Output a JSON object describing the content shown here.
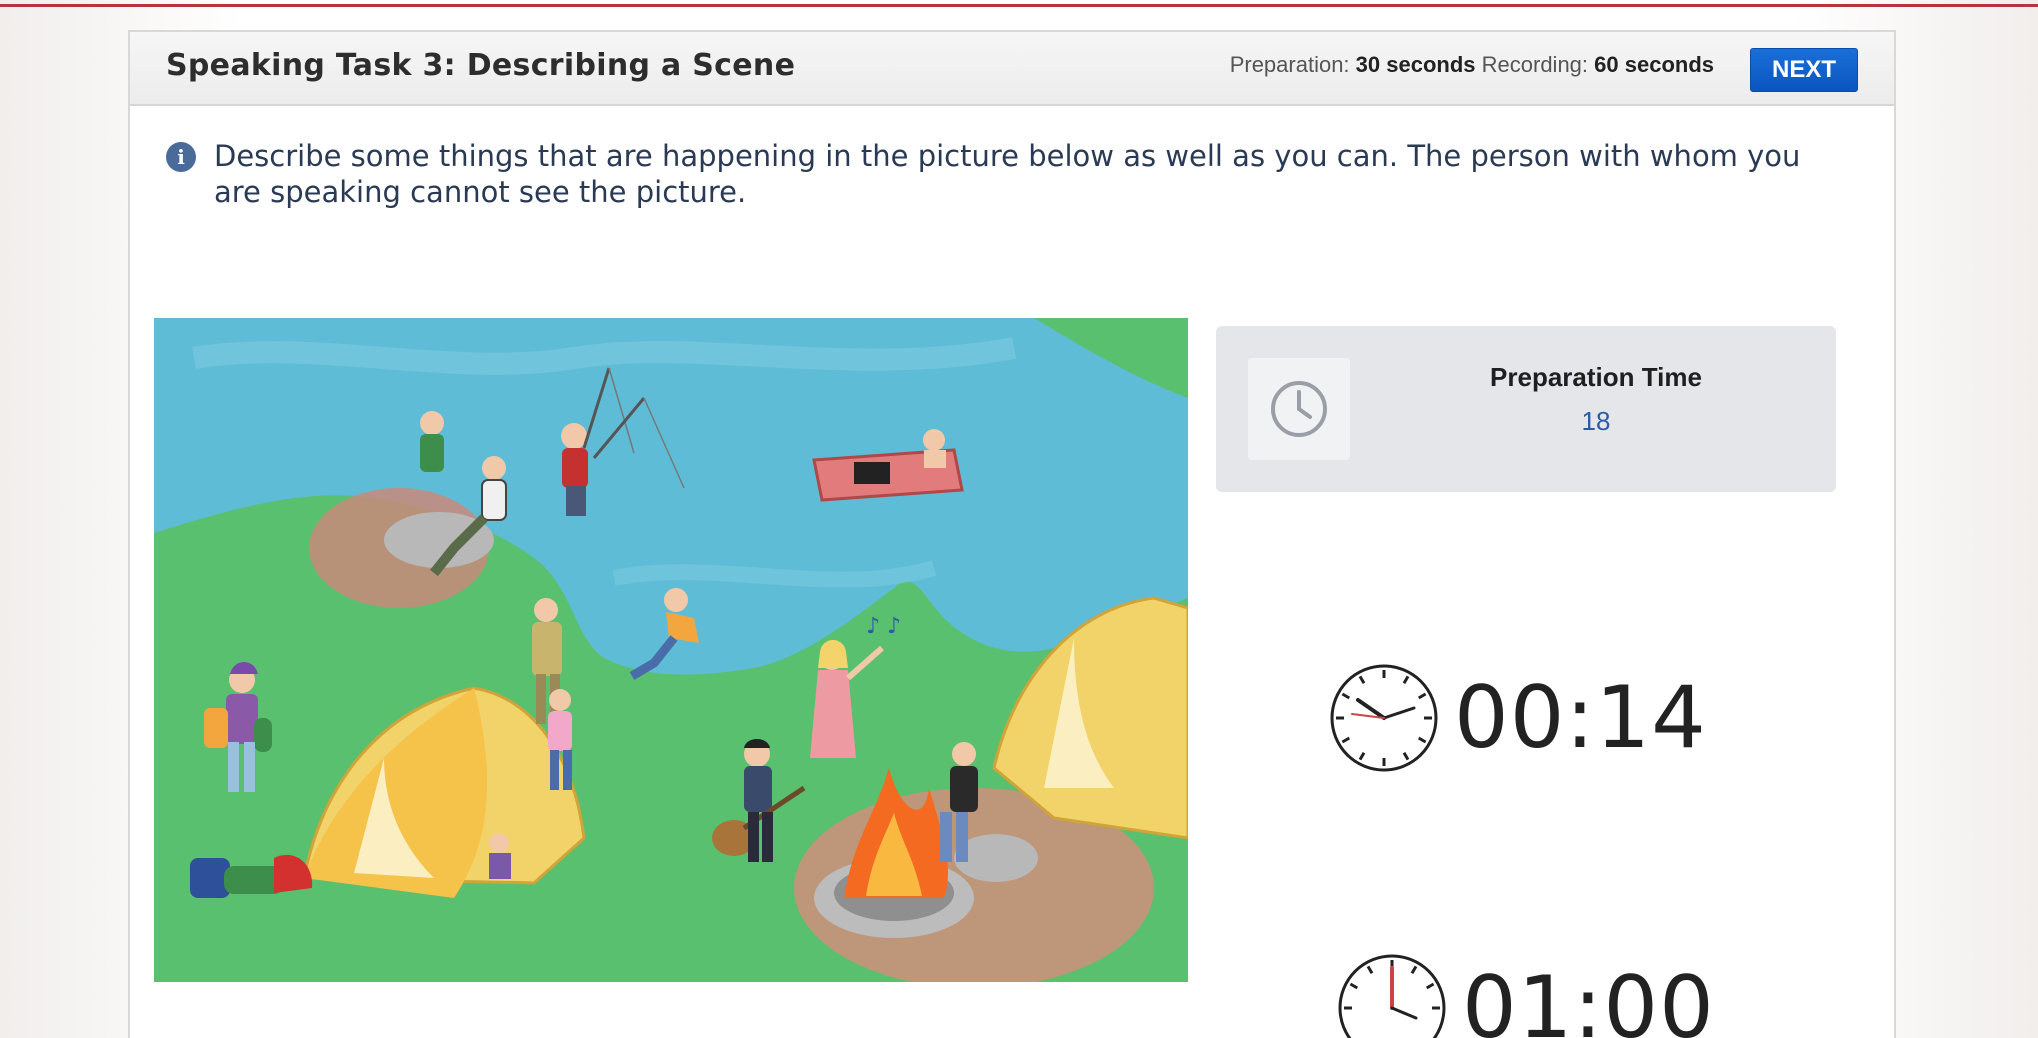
{
  "task": {
    "title": "Speaking Task 3: Describing a Scene",
    "preparation_label": "Preparation:",
    "preparation_value": "30 seconds",
    "recording_label": "Recording:",
    "recording_value": "60 seconds",
    "next_label": "NEXT"
  },
  "instruction": {
    "icon": "info-icon",
    "text": "Describe some things that are happening in the picture below as well as you can. The person with whom you are speaking cannot see the picture."
  },
  "preparation_card": {
    "icon": "clock-icon",
    "label": "Preparation Time",
    "value": "18"
  },
  "timers": {
    "preparation_elapsed": "00:14",
    "recording_remaining": "01:00"
  },
  "colors": {
    "accent_red": "#b8323f",
    "next_button": "#0b55bf",
    "prep_value": "#2a5ca8",
    "lake": "#5fbcd6",
    "grass": "#58c06e"
  }
}
